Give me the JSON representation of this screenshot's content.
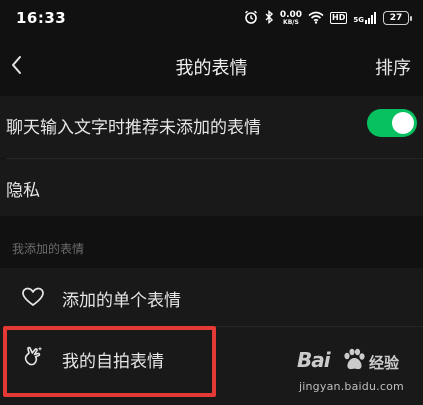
{
  "status_bar": {
    "time": "16:33",
    "net_speed_value": "0.00",
    "net_speed_unit": "KB/S",
    "hd_label": "HD",
    "signal_label": "5G",
    "battery_level": "27"
  },
  "nav": {
    "title": "我的表情",
    "sort_label": "排序"
  },
  "settings": {
    "recommend_label": "聊天输入文字时推荐未添加的表情",
    "recommend_enabled": true,
    "privacy_label": "隐私"
  },
  "section": {
    "title": "我添加的表情"
  },
  "items": [
    {
      "label": "添加的单个表情",
      "icon": "heart-icon"
    },
    {
      "label": "我的自拍表情",
      "icon": "selfie-hand-icon"
    }
  ],
  "colors": {
    "background": "#111111",
    "row_background": "#191919",
    "toggle_on": "#07c160",
    "highlight": "#e53935"
  },
  "watermark": {
    "brand": "Bai",
    "brand_suffix": "经验",
    "url": "jingyan.baidu.com"
  }
}
